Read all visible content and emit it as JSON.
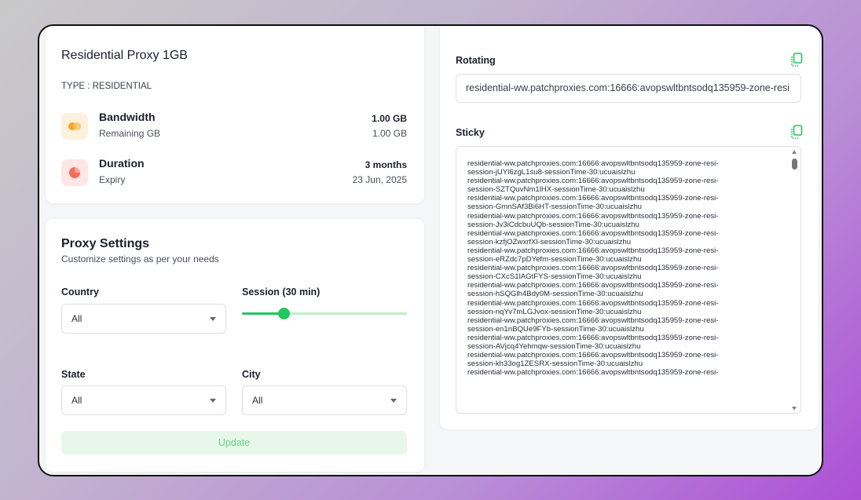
{
  "plan": {
    "title": "Residential Proxy 1GB",
    "type": "TYPE : RESIDENTIAL",
    "bandwidth": {
      "label": "Bandwidth",
      "sublabel": "Remaining GB",
      "value": "1.00 GB",
      "remaining": "1.00 GB"
    },
    "duration": {
      "label": "Duration",
      "sublabel": "Expiry",
      "value": "3 months",
      "expiry": "23 Jun, 2025"
    }
  },
  "settings": {
    "title": "Proxy Settings",
    "subtitle": "Customize settings as per your needs",
    "country": {
      "label": "Country",
      "value": "All"
    },
    "session": {
      "label": "Session (30 min)",
      "fraction": 0.25
    },
    "state": {
      "label": "State",
      "value": "All"
    },
    "city": {
      "label": "City",
      "value": "All"
    },
    "update_label": "Update"
  },
  "rotating": {
    "label": "Rotating",
    "value": "residential-ww.patchproxies.com:16666:avopswltbntsodq135959-zone-resi"
  },
  "sticky": {
    "label": "Sticky",
    "lines": [
      "residential-ww.patchproxies.com:16666:avopswltbntsodq135959-zone-resi-",
      "session-jUYl6zgL1su8-sessionTime-30:ucuaislzhu",
      "residential-ww.patchproxies.com:16666:avopswltbntsodq135959-zone-resi-",
      "session-SZTQuvNm1lHX-sessionTime-30:ucuaislzhu",
      "residential-ww.patchproxies.com:16666:avopswltbntsodq135959-zone-resi-",
      "session-GmnSAf3Bi6HT-sessionTime-30:ucuaislzhu",
      "residential-ww.patchproxies.com:16666:avopswltbntsodq135959-zone-resi-",
      "session-Jv3iCdcbuUQb-sessionTime-30:ucuaislzhu",
      "residential-ww.patchproxies.com:16666:avopswltbntsodq135959-zone-resi-",
      "session-kzfjOZwxrfXl-sessionTime-30:ucuaislzhu",
      "residential-ww.patchproxies.com:16666:avopswltbntsodq135959-zone-resi-",
      "session-eRZdc7pDYefm-sessionTime-30:ucuaislzhu",
      "residential-ww.patchproxies.com:16666:avopswltbntsodq135959-zone-resi-",
      "session-CXcS1lAGtFYS-sessionTime-30:ucuaislzhu",
      "residential-ww.patchproxies.com:16666:avopswltbntsodq135959-zone-resi-",
      "session-hSQGlh4Bdy0M-sessionTime-30:ucuaislzhu",
      "residential-ww.patchproxies.com:16666:avopswltbntsodq135959-zone-resi-",
      "session-nqYv7mLGJvox-sessionTime-30:ucuaislzhu",
      "residential-ww.patchproxies.com:16666:avopswltbntsodq135959-zone-resi-",
      "session-en1nBQUe9FYb-sessionTime-30:ucuaislzhu",
      "residential-ww.patchproxies.com:16666:avopswltbntsodq135959-zone-resi-",
      "session-AVjcq4Yehmqw-sessionTime-30:ucuaislzhu",
      "residential-ww.patchproxies.com:16666:avopswltbntsodq135959-zone-resi-",
      "session-kh33og1ZESRX-sessionTime-30:ucuaislzhu",
      "residential-ww.patchproxies.com:16666:avopswltbntsodq135959-zone-resi-"
    ]
  },
  "colors": {
    "accent": "#22c55e",
    "bandwidth_icon": "#f5a524",
    "duration_icon": "#f26b5b"
  }
}
